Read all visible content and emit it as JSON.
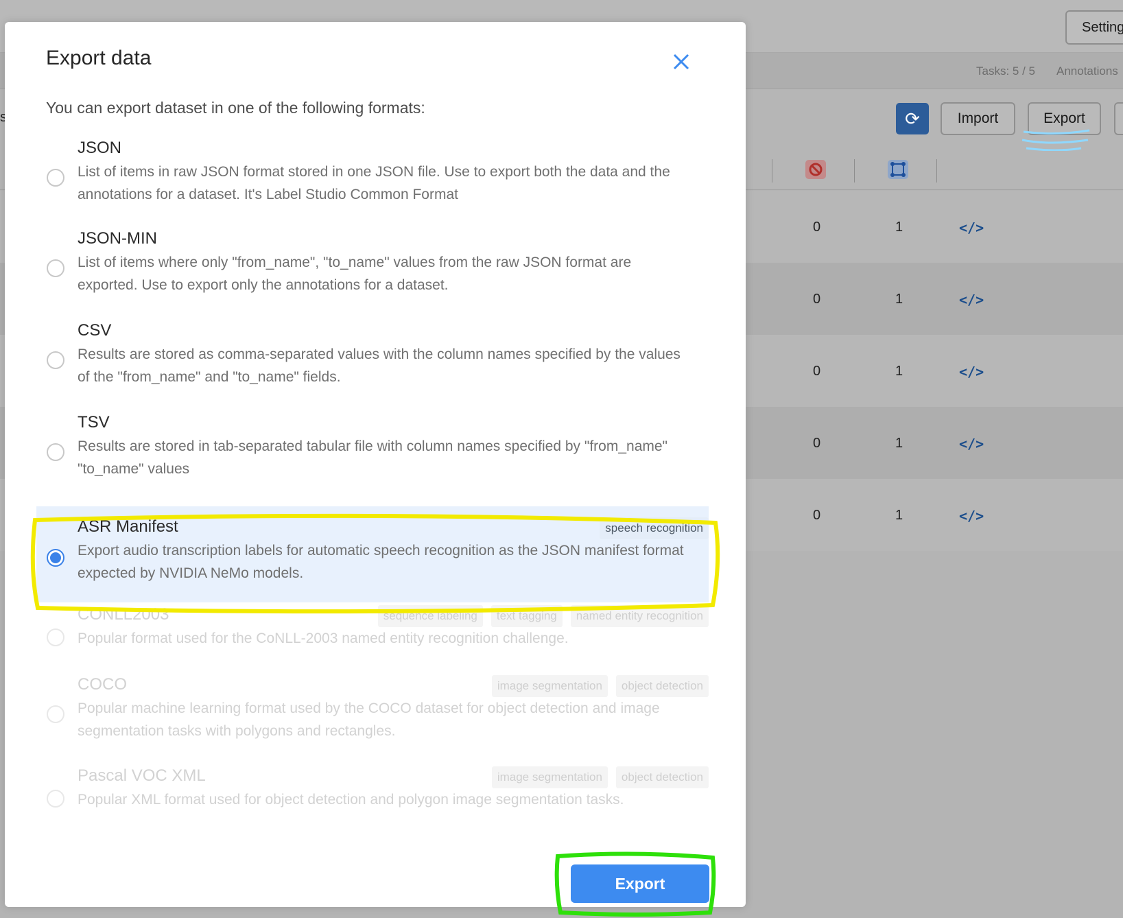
{
  "background": {
    "settings_label": "Settings",
    "stats": {
      "tasks": "Tasks: 5 / 5",
      "annotations": "Annotations"
    },
    "left_edge_text": "s",
    "toolbar": {
      "import_label": "Import",
      "export_label": "Export"
    },
    "rows": [
      {
        "rejected": "0",
        "total": "1",
        "code_icon": "</>"
      },
      {
        "rejected": "0",
        "total": "1",
        "code_icon": "</>"
      },
      {
        "rejected": "0",
        "total": "1",
        "code_icon": "</>"
      },
      {
        "rejected": "0",
        "total": "1",
        "code_icon": "</>"
      },
      {
        "rejected": "0",
        "total": "1",
        "code_icon": "</>"
      }
    ]
  },
  "modal": {
    "title": "Export data",
    "intro": "You can export dataset in one of the following formats:",
    "formats": [
      {
        "name": "JSON",
        "description": "List of items in raw JSON format stored in one JSON file. Use to export both the data and the annotations for a dataset. It's Label Studio Common Format",
        "tags": [],
        "state": "enabled"
      },
      {
        "name": "JSON-MIN",
        "description": "List of items where only \"from_name\", \"to_name\" values from the raw JSON format are exported. Use to export only the annotations for a dataset.",
        "tags": [],
        "state": "enabled"
      },
      {
        "name": "CSV",
        "description": "Results are stored as comma-separated values with the column names specified by the values of the \"from_name\" and \"to_name\" fields.",
        "tags": [],
        "state": "enabled"
      },
      {
        "name": "TSV",
        "description": "Results are stored in tab-separated tabular file with column names specified by \"from_name\" \"to_name\" values",
        "tags": [],
        "state": "enabled"
      },
      {
        "name": "ASR Manifest",
        "description": "Export audio transcription labels for automatic speech recognition as the JSON manifest format expected by NVIDIA NeMo models.",
        "tags": [
          "speech recognition"
        ],
        "state": "selected"
      },
      {
        "name": "CONLL2003",
        "description": "Popular format used for the CoNLL-2003 named entity recognition challenge.",
        "tags": [
          "sequence labeling",
          "text tagging",
          "named entity recognition"
        ],
        "state": "disabled"
      },
      {
        "name": "COCO",
        "description": "Popular machine learning format used by the COCO dataset for object detection and image segmentation tasks with polygons and rectangles.",
        "tags": [
          "image segmentation",
          "object detection"
        ],
        "state": "disabled"
      },
      {
        "name": "Pascal VOC XML",
        "description": "Popular XML format used for object detection and polygon image segmentation tasks.",
        "tags": [
          "image segmentation",
          "object detection"
        ],
        "state": "disabled"
      }
    ],
    "export_button": "Export"
  },
  "colors": {
    "accent": "#3d8bf0",
    "selected_bg": "#e8f1fd",
    "highlight_yellow": "#f2ea00",
    "highlight_green": "#2ee00a"
  }
}
